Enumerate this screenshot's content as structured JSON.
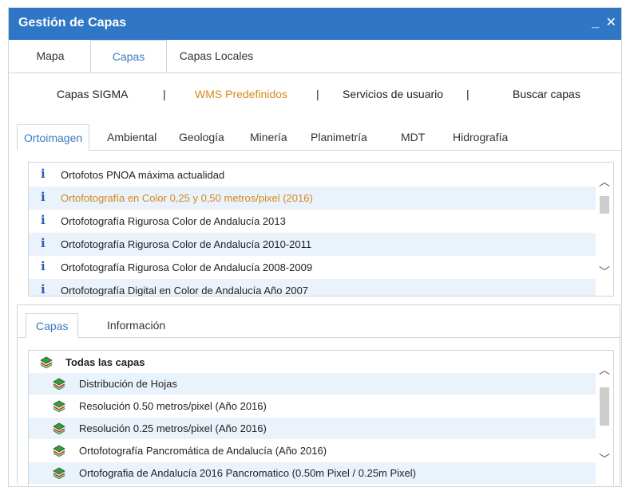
{
  "window": {
    "title": "Gestión de Capas",
    "minimize_label": "_",
    "close_label": "✕"
  },
  "main_tabs": [
    {
      "label": "Mapa"
    },
    {
      "label": "Capas"
    },
    {
      "label": "Capas Locales"
    }
  ],
  "sub_links": [
    {
      "label": "Capas SIGMA"
    },
    {
      "label": "WMS Predefinidos"
    },
    {
      "label": "Servicios de usuario"
    },
    {
      "label": "Buscar capas"
    }
  ],
  "separator": "|",
  "category_tabs": [
    {
      "label": "Ortoimagen"
    },
    {
      "label": "Ambiental"
    },
    {
      "label": "Geología"
    },
    {
      "label": "Minería"
    },
    {
      "label": "Planimetría"
    },
    {
      "label": "MDT"
    },
    {
      "label": "Hidrografía"
    }
  ],
  "wms_list": {
    "info_glyph": "i",
    "items": [
      {
        "label": "Ortofotos PNOA máxima actualidad"
      },
      {
        "label": "Ortofotografía en Color 0,25 y 0,50 metros/pixel (2016)"
      },
      {
        "label": "Ortofotografía Rigurosa Color de Andalucía 2013"
      },
      {
        "label": "Ortofotografía Rigurosa Color de Andalucía 2010-2011"
      },
      {
        "label": "Ortofotografía Rigurosa Color de Andalucía 2008-2009"
      },
      {
        "label": "Ortofotografía Digital en Color de Andalucía Año 2007"
      }
    ]
  },
  "info_tabs": [
    {
      "label": "Capas"
    },
    {
      "label": "Información"
    }
  ],
  "layers_list": {
    "items": [
      {
        "label": "Todas las capas"
      },
      {
        "label": "Distribución de Hojas"
      },
      {
        "label": "Resolución 0.50 metros/pixel (Año 2016)"
      },
      {
        "label": "Resolución 0.25 metros/pixel (Año 2016)"
      },
      {
        "label": "Ortofotografía Pancromática de Andalucía (Año 2016)"
      },
      {
        "label": "Ortofografia de Andalucía 2016 Pancromatico (0.50m Pixel / 0.25m Pixel)"
      }
    ]
  },
  "scroll": {
    "up": "︿",
    "down": "﹀"
  },
  "colors": {
    "titlebar": "#2f77c5",
    "active_tab": "#3a7bbf",
    "highlight": "#d48a1a",
    "row_alt": "#eaf2fb"
  }
}
